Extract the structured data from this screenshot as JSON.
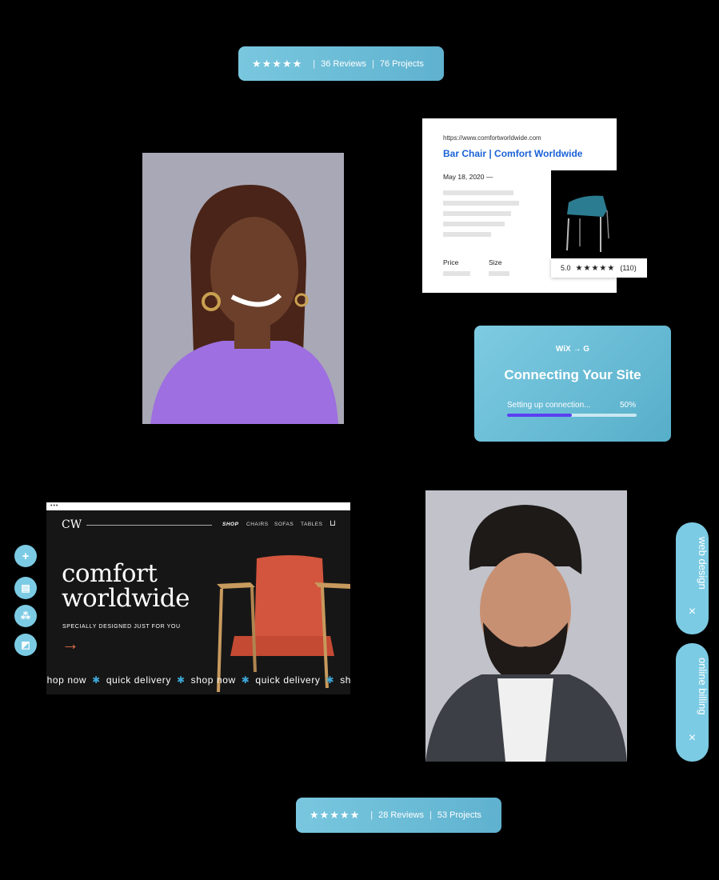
{
  "top_rating": {
    "stars": "★★★★★",
    "reviews": "36 Reviews",
    "projects": "76 Projects"
  },
  "bottom_rating": {
    "stars": "★★★★★",
    "reviews": "28 Reviews",
    "projects": "53 Projects"
  },
  "search_result": {
    "url": "https://www.comfortworldwide.com",
    "title": "Bar Chair | Comfort Worldwide",
    "date": "May 18, 2020 —",
    "price_label": "Price",
    "size_label": "Size",
    "rating": "5.0",
    "stars": "★★★★★",
    "count": "(110)"
  },
  "connect_card": {
    "brand": "WiX → G",
    "title": "Connecting Your Site",
    "status": "Setting up connection...",
    "percent": "50%",
    "progress": 0.5
  },
  "website": {
    "browser_dots": "•••",
    "logo": "CW",
    "nav": [
      "SHOP",
      "CHAIRS",
      "SOFAS",
      "TABLES"
    ],
    "cart_icon": "cart-icon",
    "heading_line1": "comfort",
    "heading_line2": "worldwide",
    "subheading": "SPECIALLY DESIGNED JUST FOR YOU",
    "arrow": "→",
    "ticker": [
      "shop now",
      "quick delivery",
      "shop now",
      "quick delivery",
      "shop no"
    ]
  },
  "tools": [
    "plus-icon",
    "page-icon",
    "paint-icon",
    "image-icon"
  ],
  "tool_glyphs": [
    "+",
    "▤",
    "⁂",
    "◩"
  ],
  "tags": [
    {
      "label": "web design",
      "close": "×"
    },
    {
      "label": "online billing",
      "close": "×"
    }
  ],
  "colors": {
    "accent": "#7ccbe4",
    "link": "#1a62d6",
    "progress": "#5b3ff2",
    "cta_arrow": "#e76c4f"
  }
}
